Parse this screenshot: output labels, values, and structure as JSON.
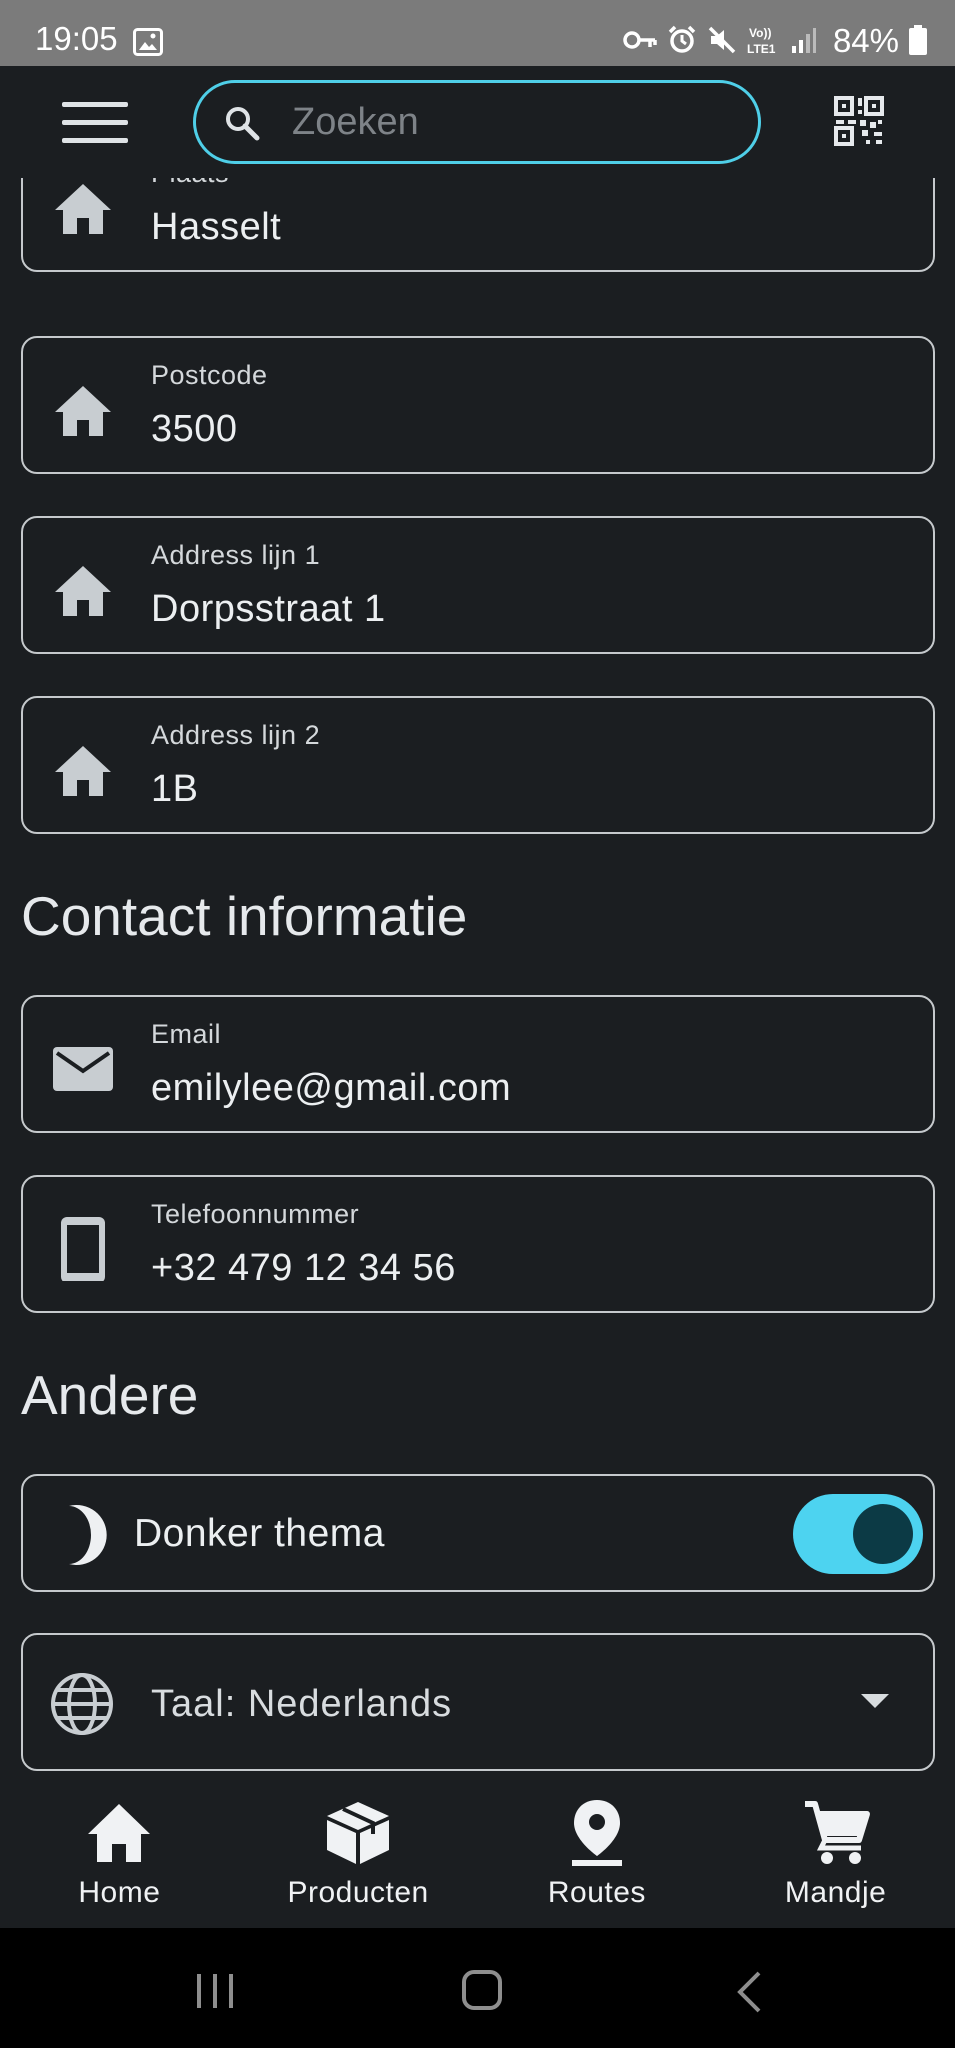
{
  "status_bar": {
    "time": "19:05",
    "battery": "84%",
    "icons": [
      "gallery-icon",
      "key-icon",
      "alarm-icon",
      "mute-icon",
      "volte-icon",
      "signal-icon",
      "battery-icon"
    ]
  },
  "app_bar": {
    "menu_icon": "hamburger-menu-icon",
    "search_placeholder": "Zoeken",
    "search_value": "",
    "qr_icon": "qr-scan-icon",
    "accent_color": "#4fcfe8"
  },
  "address": {
    "fields": [
      {
        "label": "Plaats",
        "value": "Hasselt",
        "icon": "home-icon"
      },
      {
        "label": "Postcode",
        "value": "3500",
        "icon": "home-icon"
      },
      {
        "label": "Address lijn 1",
        "value": "Dorpsstraat 1",
        "icon": "home-icon"
      },
      {
        "label": "Address lijn 2",
        "value": "1B",
        "icon": "home-icon"
      }
    ]
  },
  "contact": {
    "title": "Contact informatie",
    "fields": [
      {
        "label": "Email",
        "value": "emilylee@gmail.com",
        "icon": "email-icon"
      },
      {
        "label": "Telefoonnummer",
        "value": "+32 479 12 34 56",
        "icon": "phone-icon"
      }
    ]
  },
  "other": {
    "title": "Andere",
    "dark_theme": {
      "label": "Donker thema",
      "enabled": true,
      "icon": "moon-icon",
      "switch_color": "#4dd3f0"
    },
    "language": {
      "value": "Taal: Nederlands",
      "icon": "globe-icon"
    }
  },
  "bottom_nav": {
    "items": [
      {
        "label": "Home",
        "icon": "home-icon"
      },
      {
        "label": "Producten",
        "icon": "package-icon"
      },
      {
        "label": "Routes",
        "icon": "location-pin-icon"
      },
      {
        "label": "Mandje",
        "icon": "cart-icon"
      }
    ]
  },
  "system_nav": {
    "items": [
      "recent-apps-icon",
      "home-button-icon",
      "back-icon"
    ]
  }
}
